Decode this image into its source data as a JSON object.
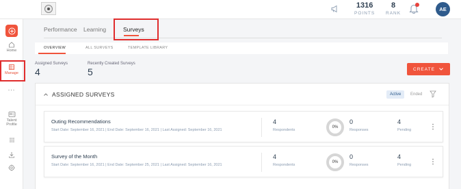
{
  "header": {
    "points_value": "1316",
    "points_label": "POINTS",
    "rank_value": "8",
    "rank_label": "RANK",
    "avatar_initials": "AE"
  },
  "sidebar": {
    "items": [
      {
        "label": "Home",
        "icon": "home-icon"
      },
      {
        "label": "Manage",
        "icon": "manage-icon",
        "active": true
      },
      {
        "label": "...",
        "icon": "more-icon"
      },
      {
        "label": "Talent Profile",
        "icon": "talent-profile-icon"
      },
      {
        "label": "",
        "icon": "grid-icon"
      },
      {
        "label": "",
        "icon": "download-icon"
      },
      {
        "label": "",
        "icon": "settings-icon"
      }
    ]
  },
  "tabs": [
    "Performance",
    "Learning",
    "Surveys"
  ],
  "active_tab": "Surveys",
  "subtabs": [
    "OVERVIEW",
    "ALL SURVEYS",
    "TEMPLATE LIBRARY"
  ],
  "summary": {
    "assigned_label": "Assigned Surveys",
    "assigned_value": "4",
    "recent_label": "Recently Created Surveys",
    "recent_value": "5"
  },
  "create_button": "CREATE",
  "panel": {
    "title": "ASSIGNED SURVEYS",
    "filter_active": "Active",
    "filter_ended": "Ended"
  },
  "surveys": [
    {
      "name": "Outing Recommendations",
      "meta": "Start Date: September 16, 2021  |  End Date: September 16, 2021  |  Last Assigned: September 16, 2021",
      "respondents": "4",
      "respondents_label": "Respondents",
      "percent": "0%",
      "responses": "0",
      "responses_label": "Responses",
      "pending": "4",
      "pending_label": "Pending"
    },
    {
      "name": "Survey of the Month",
      "meta": "Start Date: September 16, 2021  |  End Date: September 25, 2021  |  Last Assigned: September 16, 2021",
      "respondents": "4",
      "respondents_label": "Respondents",
      "percent": "0%",
      "responses": "0",
      "responses_label": "Responses",
      "pending": "4",
      "pending_label": "Pending"
    }
  ],
  "colors": {
    "accent": "#f0543c",
    "highlight_box": "#e02c2c",
    "avatar": "#2f5b8c"
  }
}
